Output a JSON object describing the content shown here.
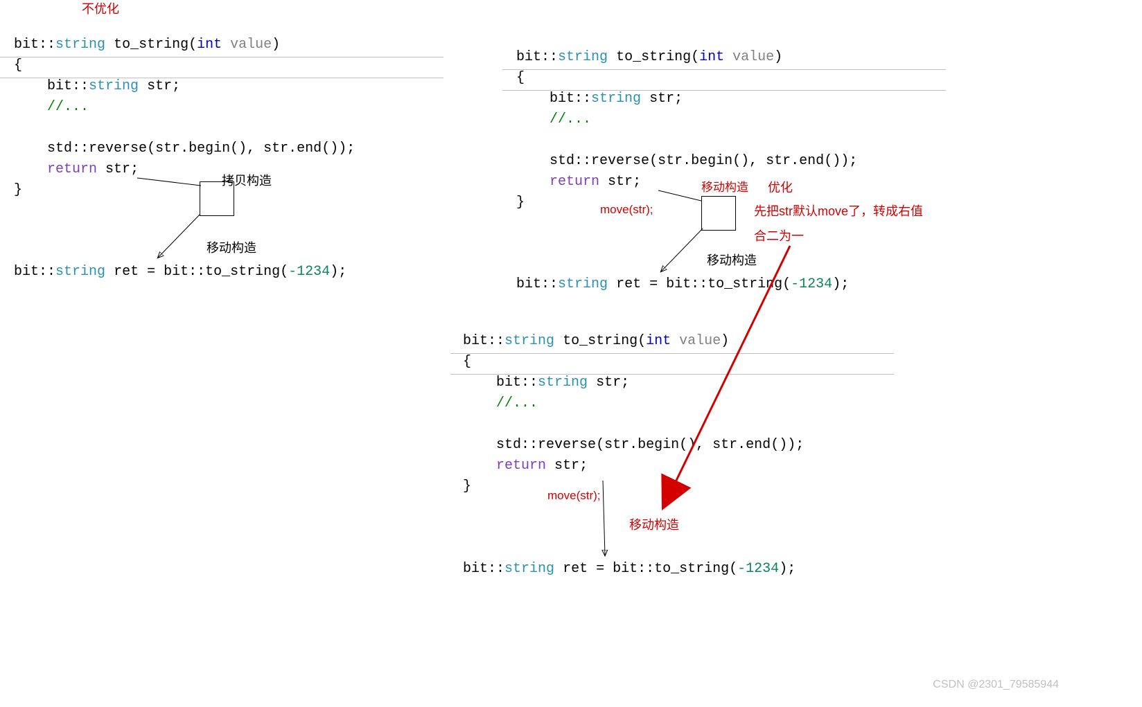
{
  "left": {
    "title_annot": "不优化",
    "code_tokens": {
      "bit": "bit",
      "string": "string",
      "fn": "to_string",
      "int": "int",
      "value": "value",
      "str": "str",
      "comment": "//...",
      "std": "std",
      "reverse": "reverse",
      "begin": "begin",
      "end": "end",
      "ret": "return",
      "retvar": "ret",
      "call": "to_string",
      "num": "-1234"
    },
    "box_label": "拷贝构造",
    "arrow_label": "移动构造"
  },
  "right_top": {
    "code_tokens": {
      "bit": "bit",
      "string": "string",
      "fn": "to_string",
      "int": "int",
      "value": "value",
      "str": "str",
      "comment": "//...",
      "std": "std",
      "reverse": "reverse",
      "begin": "begin",
      "end": "end",
      "ret": "return",
      "retvar": "ret",
      "call": "to_string",
      "num": "-1234"
    },
    "box_label": "移动构造",
    "move_label": "move(str);",
    "arrow_label": "移动构造",
    "opt_title": "优化",
    "opt_line1": "先把str默认move了，转成右值",
    "opt_line2": "合二为一"
  },
  "right_bottom": {
    "code_tokens": {
      "bit": "bit",
      "string": "string",
      "fn": "to_string",
      "int": "int",
      "value": "value",
      "str": "str",
      "comment": "//...",
      "std": "std",
      "reverse": "reverse",
      "begin": "begin",
      "end": "end",
      "ret": "return",
      "retvar": "ret",
      "call": "to_string",
      "num": "-1234"
    },
    "move_label": "move(str);",
    "arrow_label": "移动构造"
  },
  "watermark": "CSDN @2301_79585944"
}
